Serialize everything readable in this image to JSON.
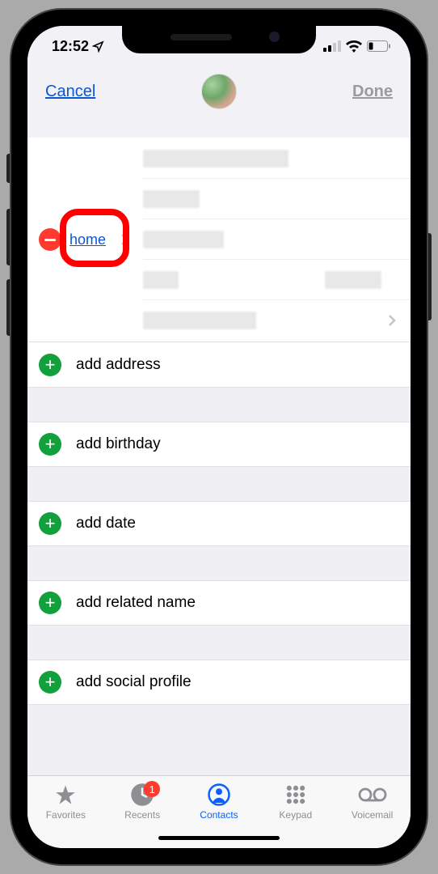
{
  "status": {
    "time": "12:52",
    "location_icon": "location-arrow",
    "signal_bars": 3,
    "wifi": true,
    "battery_low": true
  },
  "nav": {
    "cancel": "Cancel",
    "done": "Done"
  },
  "address": {
    "label": "home",
    "fields_count": 5
  },
  "add_rows": [
    {
      "label": "add address",
      "name": "add-address"
    },
    {
      "label": "add birthday",
      "name": "add-birthday"
    },
    {
      "label": "add date",
      "name": "add-date"
    },
    {
      "label": "add related name",
      "name": "add-related-name"
    },
    {
      "label": "add social profile",
      "name": "add-social-profile"
    }
  ],
  "tabs": {
    "favorites": "Favorites",
    "recents": "Recents",
    "recents_badge": "1",
    "contacts": "Contacts",
    "keypad": "Keypad",
    "voicemail": "Voicemail",
    "active": "contacts"
  }
}
